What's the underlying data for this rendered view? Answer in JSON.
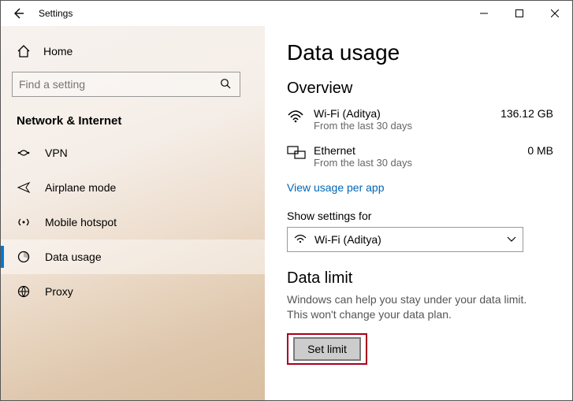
{
  "titlebar": {
    "app_title": "Settings"
  },
  "sidebar": {
    "home_label": "Home",
    "search_placeholder": "Find a setting",
    "category": "Network & Internet",
    "items": [
      {
        "label": "VPN"
      },
      {
        "label": "Airplane mode"
      },
      {
        "label": "Mobile hotspot"
      },
      {
        "label": "Data usage"
      },
      {
        "label": "Proxy"
      }
    ]
  },
  "main": {
    "page_title": "Data usage",
    "overview_heading": "Overview",
    "usage": [
      {
        "name": "Wi-Fi (Aditya)",
        "sub": "From the last 30 days",
        "value": "136.12 GB"
      },
      {
        "name": "Ethernet",
        "sub": "From the last 30 days",
        "value": "0 MB"
      }
    ],
    "view_link": "View usage per app",
    "show_settings_label": "Show settings for",
    "combo_value": "Wi-Fi (Aditya)",
    "data_limit_heading": "Data limit",
    "data_limit_helper": "Windows can help you stay under your data limit. This won't change your data plan.",
    "set_limit_label": "Set limit"
  }
}
